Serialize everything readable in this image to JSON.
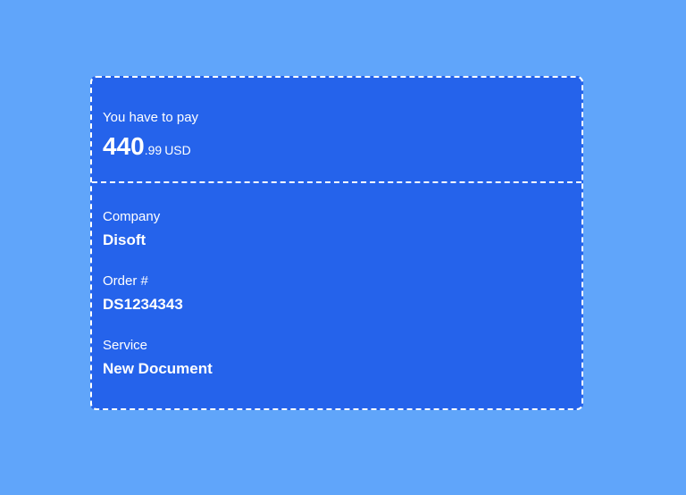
{
  "payment": {
    "label": "You have to pay",
    "amount_main": "440",
    "amount_cents": ".99",
    "currency": "USD"
  },
  "details": {
    "company_label": "Company",
    "company_value": "Disoft",
    "order_label": "Order #",
    "order_value": "DS1234343",
    "service_label": "Service",
    "service_value": "New Document"
  },
  "colors": {
    "background": "#60a5fa",
    "card": "#2563eb",
    "text": "#ffffff"
  }
}
